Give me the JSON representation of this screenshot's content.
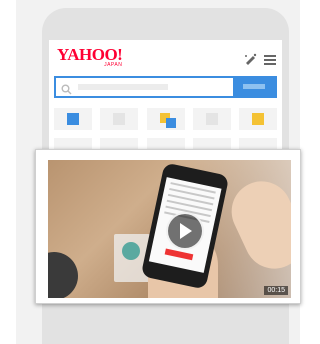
{
  "header": {
    "logo_text": "YAHOO!",
    "logo_subtext": "JAPAN",
    "tools_icon": "pen-sparkle-icon",
    "menu_icon": "hamburger-menu-icon"
  },
  "search": {
    "icon": "search-icon",
    "placeholder": ""
  },
  "service_icons": [
    "#3b8de0",
    "#e8e8e8",
    "#f4c234",
    "#e8e8e8",
    "#f4c234"
  ],
  "video": {
    "duration": "00:15",
    "play_icon": "play-icon"
  },
  "colors": {
    "brand_red": "#ff0033",
    "accent_blue": "#3b8de0"
  }
}
